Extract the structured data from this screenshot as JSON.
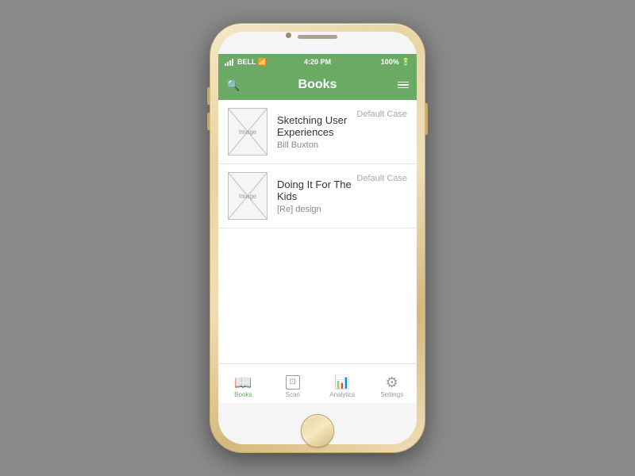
{
  "phone": {
    "statusBar": {
      "carrier": "BELL",
      "signal": "●●●○○",
      "time": "4:20 PM",
      "wifi": "WiFi",
      "battery": "100%"
    },
    "navBar": {
      "title": "Books",
      "searchIcon": "🔍",
      "menuIcon": "≡"
    },
    "books": [
      {
        "title": "Sketching User Experiences",
        "subtitle": "Bill Buxton",
        "case": "Default Case",
        "imageLabel": "Image"
      },
      {
        "title": "Doing It For The Kids",
        "subtitle": "[Re] design",
        "case": "Default Case",
        "imageLabel": "Image"
      }
    ],
    "tabs": [
      {
        "label": "Books",
        "icon": "📖",
        "active": true
      },
      {
        "label": "Scan",
        "icon": "⊡",
        "active": false
      },
      {
        "label": "Analytics",
        "icon": "📈",
        "active": false
      },
      {
        "label": "Settings",
        "icon": "⚙",
        "active": false
      }
    ]
  }
}
